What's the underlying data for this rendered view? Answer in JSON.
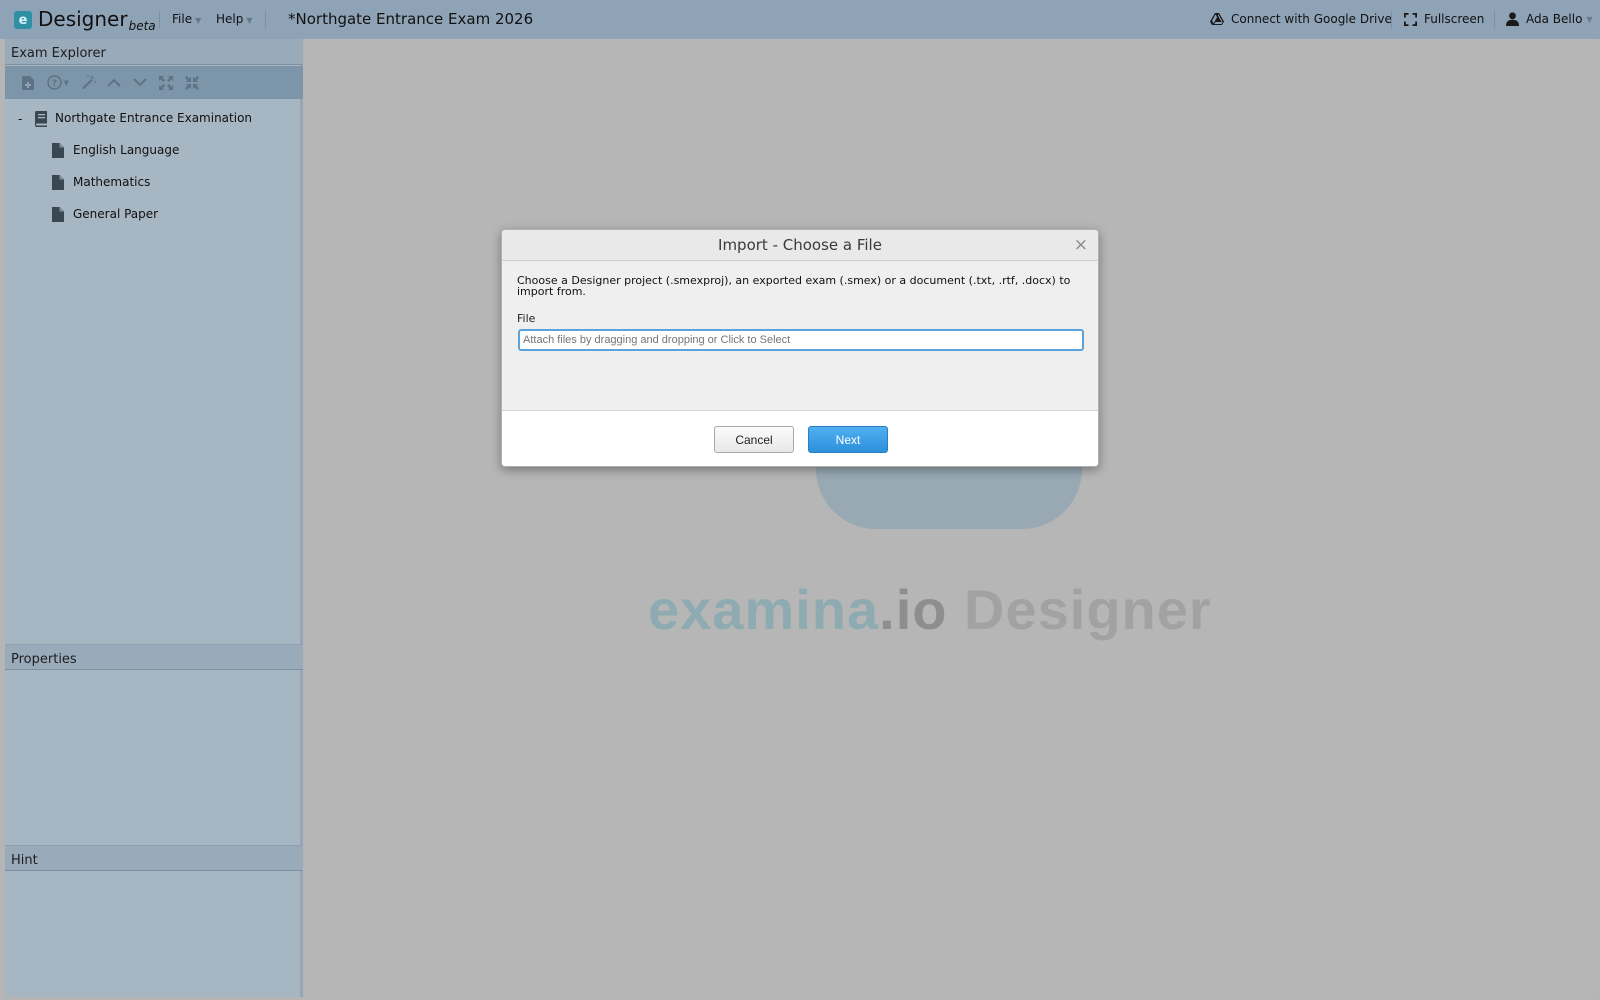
{
  "app": {
    "logo_letter": "e",
    "name": "Designer",
    "badge": "beta",
    "menus": [
      {
        "label": "File"
      },
      {
        "label": "Help"
      }
    ],
    "document_title": "*Northgate Entrance Exam 2026",
    "actions": {
      "drive_label": "Connect with Google Drive",
      "fullscreen_label": "Fullscreen",
      "user_name": "Ada Bello"
    }
  },
  "left_panel": {
    "explorer_title": "Exam Explorer",
    "tree": {
      "root": {
        "toggle": "-",
        "label": "Northgate Entrance Examination"
      },
      "children": [
        {
          "label": "English Language"
        },
        {
          "label": "Mathematics"
        },
        {
          "label": "General Paper"
        }
      ]
    },
    "properties_title": "Properties",
    "hint_title": "Hint"
  },
  "watermark": {
    "part1": "examina",
    "part2": ".io",
    "part3": " Designer"
  },
  "modal": {
    "title": "Import - Choose a File",
    "close_glyph": "×",
    "description": "Choose a Designer project (.smexproj), an exported exam (.smex) or a document (.txt, .rtf, .docx) to import from.",
    "file_label": "File",
    "file_placeholder": "Attach files by dragging and dropping or Click to Select",
    "cancel_label": "Cancel",
    "next_label": "Next"
  },
  "colors": {
    "accent": "#2e8fdc",
    "logo": "#2f8fa5"
  },
  "icons": [
    "drive-icon",
    "fullscreen-icon",
    "user-icon",
    "book-icon",
    "document-icon",
    "close-icon"
  ]
}
